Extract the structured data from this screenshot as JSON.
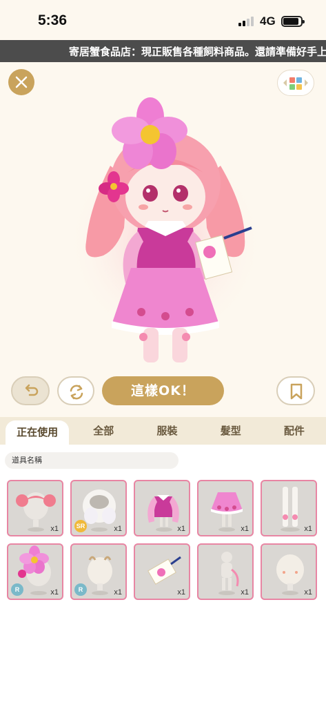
{
  "status_bar": {
    "time": "5:36",
    "network": "4G",
    "signal_bars": 2
  },
  "ticker": {
    "text": "寄居蟹食品店：現正販售各種飼料商品。還請準備好手上"
  },
  "stage": {
    "confirm_label": "這樣OK！"
  },
  "tabs": [
    {
      "label": "正在使用",
      "active": true
    },
    {
      "label": "全部",
      "active": false
    },
    {
      "label": "服裝",
      "active": false
    },
    {
      "label": "髮型",
      "active": false
    },
    {
      "label": "配件",
      "active": false
    }
  ],
  "filter": {
    "label": "道具名稱"
  },
  "items": [
    {
      "icon": "pink-pigtail-hair-icon",
      "qty": "x1",
      "rarity": ""
    },
    {
      "icon": "white-wavy-hair-icon",
      "qty": "x1",
      "rarity": "SR"
    },
    {
      "icon": "pink-blouse-icon",
      "qty": "x1",
      "rarity": ""
    },
    {
      "icon": "pink-flower-skirt-icon",
      "qty": "x1",
      "rarity": ""
    },
    {
      "icon": "white-socks-icon",
      "qty": "x1",
      "rarity": ""
    },
    {
      "icon": "cosmos-flower-headpiece-icon",
      "qty": "x1",
      "rarity": "R"
    },
    {
      "icon": "hair-ornament-icon",
      "qty": "x1",
      "rarity": "R"
    },
    {
      "icon": "flower-letter-icon",
      "qty": "x1",
      "rarity": ""
    },
    {
      "icon": "pink-ribbon-body-icon",
      "qty": "x1",
      "rarity": ""
    },
    {
      "icon": "blush-face-icon",
      "qty": "x1",
      "rarity": ""
    }
  ],
  "colors": {
    "gold": "#c9a35c",
    "cream": "#fdf8ef",
    "item_border": "#e885a3",
    "ticker_bg": "#4c4c4c"
  }
}
